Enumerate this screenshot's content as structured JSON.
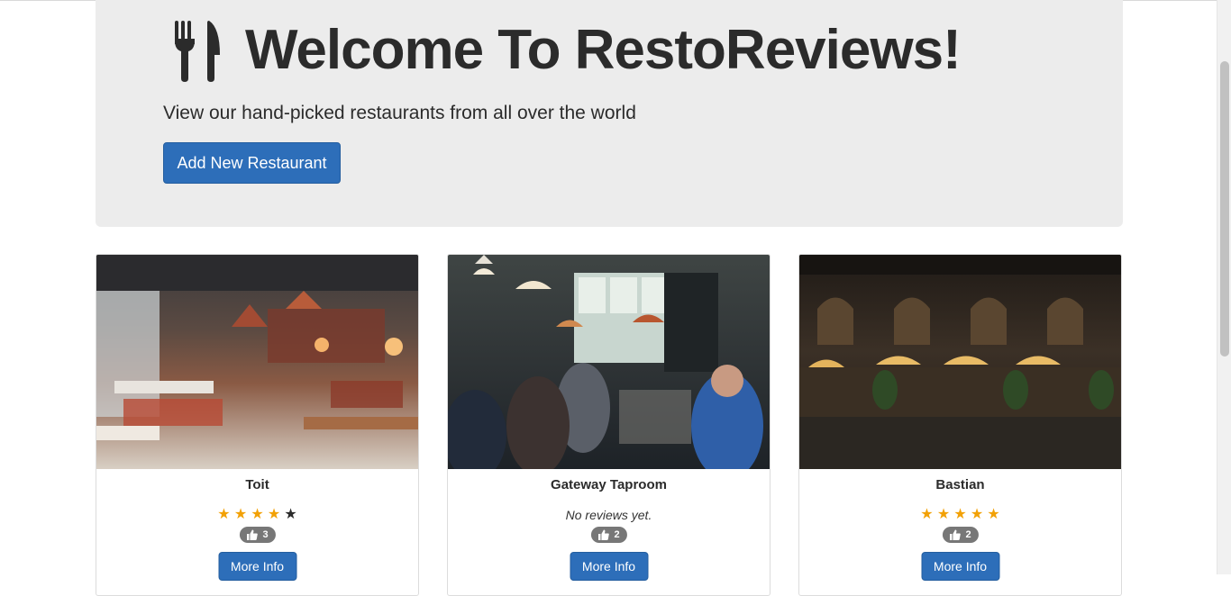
{
  "hero": {
    "title": "Welcome To RestoReviews!",
    "subtitle": "View our hand-picked restaurants from all over the world",
    "add_button_label": "Add New Restaurant",
    "icon": "utensils-icon"
  },
  "restaurants": [
    {
      "name": "Toit",
      "rating_filled": 4,
      "rating_max": 5,
      "rating_text": "",
      "likes": "3",
      "button_label": "More Info",
      "image": "restaurant-interior-photo"
    },
    {
      "name": "Gateway Taproom",
      "rating_filled": 0,
      "rating_max": 5,
      "rating_text": "No reviews yet.",
      "likes": "2",
      "button_label": "More Info",
      "image": "taproom-crowd-photo"
    },
    {
      "name": "Bastian",
      "rating_filled": 5,
      "rating_max": 5,
      "rating_text": "",
      "likes": "2",
      "button_label": "More Info",
      "image": "night-terrace-photo"
    }
  ],
  "colors": {
    "primary": "#2d6eb9",
    "star": "#f2a106",
    "badge": "#777777",
    "jumbotron": "#ececec"
  }
}
